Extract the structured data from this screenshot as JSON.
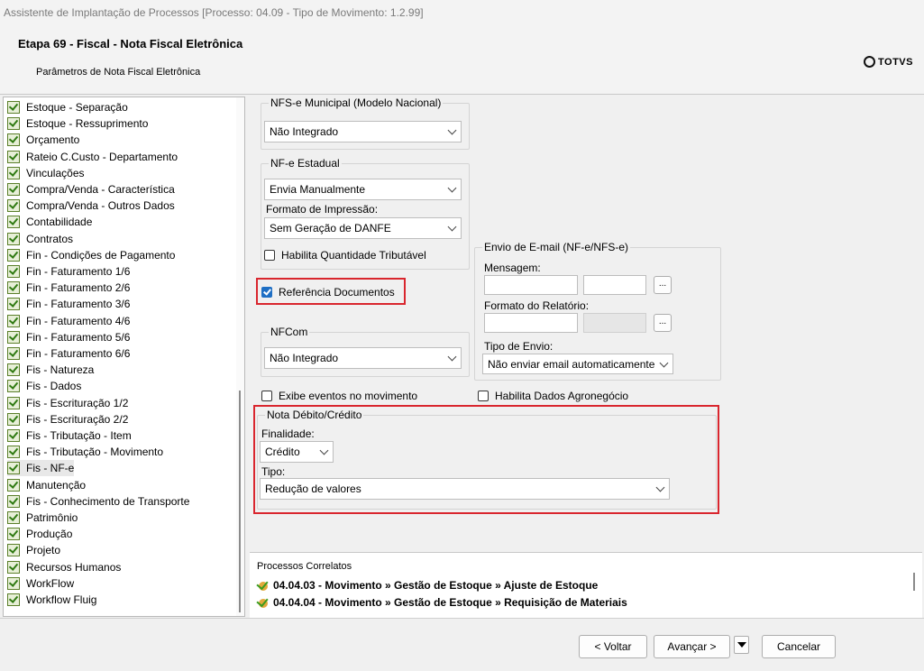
{
  "window": {
    "title": "Assistente de Implantação de Processos [Processo: 04.09 - Tipo de Movimento: 1.2.99]"
  },
  "header": {
    "step_title": "Etapa 69 - Fiscal - Nota Fiscal Eletrônica",
    "subtitle": "Parâmetros de Nota Fiscal Eletrônica",
    "logo": "TOTVS"
  },
  "tree": {
    "items": [
      {
        "label": "Estoque - Separação"
      },
      {
        "label": "Estoque - Ressuprimento"
      },
      {
        "label": "Orçamento"
      },
      {
        "label": "Rateio C.Custo - Departamento"
      },
      {
        "label": "Vinculações"
      },
      {
        "label": "Compra/Venda - Característica"
      },
      {
        "label": "Compra/Venda - Outros Dados"
      },
      {
        "label": "Contabilidade"
      },
      {
        "label": "Contratos"
      },
      {
        "label": "Fin - Condições de Pagamento"
      },
      {
        "label": "Fin - Faturamento 1/6"
      },
      {
        "label": "Fin - Faturamento 2/6"
      },
      {
        "label": "Fin - Faturamento 3/6"
      },
      {
        "label": "Fin - Faturamento 4/6"
      },
      {
        "label": "Fin - Faturamento 5/6"
      },
      {
        "label": "Fin - Faturamento 6/6"
      },
      {
        "label": "Fis - Natureza"
      },
      {
        "label": "Fis - Dados"
      },
      {
        "label": "Fis - Escrituração 1/2"
      },
      {
        "label": "Fis - Escrituração 2/2"
      },
      {
        "label": "Fis - Tributação - Item"
      },
      {
        "label": "Fis - Tributação - Movimento"
      },
      {
        "label": "Fis - NF-e",
        "selected": true
      },
      {
        "label": "Manutenção"
      },
      {
        "label": "Fis - Conhecimento de Transporte"
      },
      {
        "label": "Patrimônio"
      },
      {
        "label": "Produção"
      },
      {
        "label": "Projeto"
      },
      {
        "label": "Recursos Humanos"
      },
      {
        "label": "WorkFlow"
      },
      {
        "label": "Workflow Fluig"
      }
    ]
  },
  "nfse": {
    "legend": "NFS-e Municipal (Modelo Nacional)",
    "value": "Não Integrado"
  },
  "nfe": {
    "legend": "NF-e Estadual",
    "value": "Envia Manualmente",
    "formato_label": "Formato de Impressão:",
    "formato_value": "Sem Geração de DANFE",
    "habilita_qtd": "Habilita Quantidade Tributável"
  },
  "referencia": {
    "label": "Referência Documentos",
    "checked": true
  },
  "nfcom": {
    "legend": "NFCom",
    "value": "Não Integrado"
  },
  "email": {
    "legend": "Envio de E-mail (NF-e/NFS-e)",
    "mensagem_label": "Mensagem:",
    "formato_label": "Formato do Relatório:",
    "tipo_label": "Tipo de Envio:",
    "tipo_value": "Não enviar email automaticamente",
    "dots": "..."
  },
  "exibe_eventos": "Exibe eventos no movimento",
  "agronegocio": "Habilita Dados Agronegócio",
  "nota_debito": {
    "legend": "Nota Débito/Crédito",
    "finalidade_label": "Finalidade:",
    "finalidade_value": "Crédito",
    "tipo_label": "Tipo:",
    "tipo_value": "Redução de valores"
  },
  "correlatos": {
    "title": "Processos Correlatos",
    "items": [
      "04.04.03 - Movimento » Gestão de Estoque » Ajuste de Estoque",
      "04.04.04 - Movimento » Gestão de Estoque » Requisição de Materiais"
    ]
  },
  "footer": {
    "voltar": "< Voltar",
    "avancar": "Avançar >",
    "cancelar": "Cancelar"
  },
  "colors": {
    "highlight": "#d9262e",
    "checkbox_on": "#1f6fc4"
  }
}
